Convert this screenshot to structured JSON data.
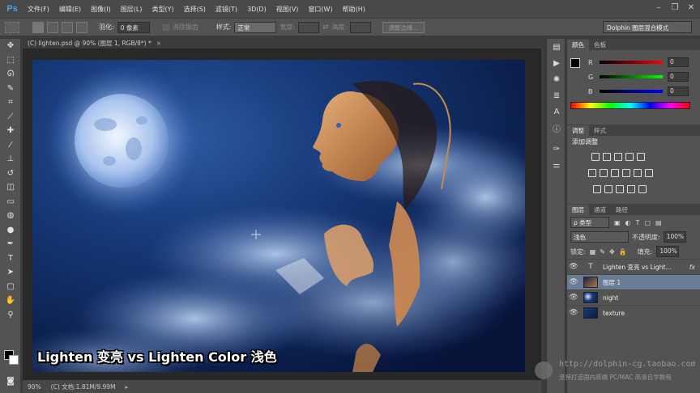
{
  "app": {
    "logo": "Ps"
  },
  "menu": [
    "文件(F)",
    "编辑(E)",
    "图像(I)",
    "图层(L)",
    "类型(Y)",
    "选择(S)",
    "滤镜(T)",
    "3D(D)",
    "视图(V)",
    "窗口(W)",
    "帮助(H)"
  ],
  "options": {
    "feather_label": "羽化:",
    "feather_value": "0 像素",
    "antialias_label": "消除锯齿",
    "style_label": "样式:",
    "style_value": "正常",
    "width_label": "宽度:",
    "height_label": "高度:",
    "refine_edge": "调整边缘...",
    "workspace": "Dolphin 图层混合模式"
  },
  "document": {
    "tab_title": "(C) lighten.psd @ 90% (图层 1, RGB/8*) *",
    "caption": "Lighten 变亮 vs Lighten Color 浅色"
  },
  "status": {
    "zoom": "90%",
    "doc_info": "(C) 文档:1.81M/9.99M"
  },
  "color_panel": {
    "tabs": [
      "颜色",
      "色板"
    ],
    "r_label": "R",
    "g_label": "G",
    "b_label": "B",
    "r_value": "0",
    "g_value": "0",
    "b_value": "0"
  },
  "adjust_panel": {
    "tabs": [
      "调整",
      "样式"
    ],
    "title": "添加调整"
  },
  "layers_panel": {
    "tabs": [
      "图层",
      "通道",
      "路径"
    ],
    "filter_label": "ρ 类型",
    "blend_mode": "浅色",
    "opacity_label": "不透明度:",
    "opacity_value": "100%",
    "lock_label": "锁定:",
    "fill_label": "填充:",
    "fill_value": "100%",
    "layers": [
      {
        "name": "Lighten 变亮  vs Light...",
        "type": "text"
      },
      {
        "name": "图层 1",
        "type": "image"
      },
      {
        "name": "night",
        "type": "image"
      },
      {
        "name": "texture",
        "type": "image"
      }
    ]
  },
  "watermark": {
    "url": "http://dolphin-cg.taobao.com",
    "tagline": "坚持打造国内高端 PC/MAC 高清自学教程"
  },
  "colors": {
    "accent": "#4aa3e8",
    "selected_layer": "#6a7c93",
    "sky_dark": "#0a1a44",
    "sky_light": "#3a63a8"
  }
}
